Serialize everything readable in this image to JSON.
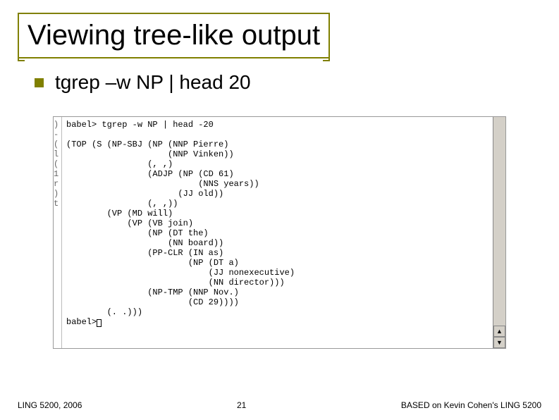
{
  "slide": {
    "title": "Viewing tree-like output",
    "bullet": "tgrep –w NP | head 20"
  },
  "terminal": {
    "prompt1": "babel> tgrep -w NP | head -20",
    "tree": "(TOP (S (NP-SBJ (NP (NNP Pierre)\n                    (NNP Vinken))\n                (, ,)\n                (ADJP (NP (CD 61)\n                          (NNS years))\n                      (JJ old))\n                (, ,))\n        (VP (MD will)\n            (VP (VB join)\n                (NP (DT the)\n                    (NN board))\n                (PP-CLR (IN as)\n                        (NP (DT a)\n                            (JJ nonexecutive)\n                            (NN director)))\n                (NP-TMP (NNP Nov.)\n                        (CD 29))))\n        (. .)))",
    "prompt2": "babel>"
  },
  "left_fragments": [
    "",
    ")",
    "-",
    "(",
    "l",
    "(",
    "1",
    "r",
    ")",
    "",
    "t"
  ],
  "footer": {
    "left": "LING 5200, 2006",
    "center": "21",
    "right": "BASED on Kevin Cohen's LING 5200"
  }
}
